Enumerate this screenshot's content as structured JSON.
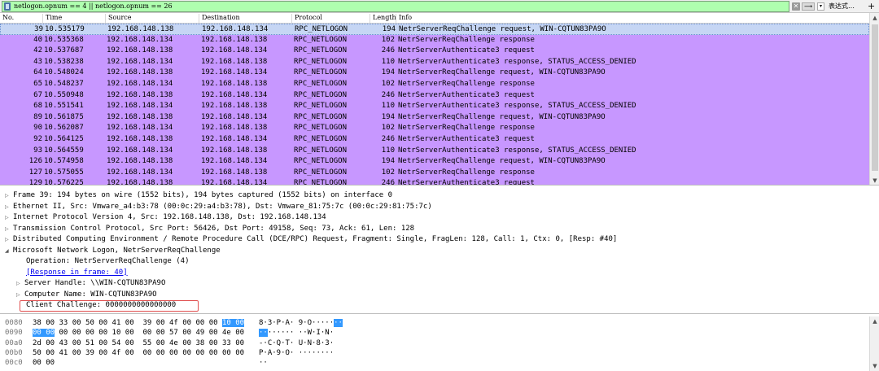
{
  "filter": {
    "expression": "netlogon.opnum == 4 || netlogon.opnum == 26",
    "clear_label": "✕",
    "apply_label": "⟶",
    "dropdown_label": "▾",
    "expression_label": "表达式…",
    "add_label": "+"
  },
  "packet_list": {
    "columns": [
      "No.",
      "Time",
      "Source",
      "Destination",
      "Protocol",
      "Length",
      "Info"
    ],
    "rows": [
      {
        "no": "39",
        "time": "10.535179",
        "src": "192.168.148.138",
        "dst": "192.168.148.134",
        "proto": "RPC_NETLOGON",
        "len": "194",
        "info": "NetrServerReqChallenge request, WIN-CQTUN83PA9O"
      },
      {
        "no": "40",
        "time": "10.535368",
        "src": "192.168.148.134",
        "dst": "192.168.148.138",
        "proto": "RPC_NETLOGON",
        "len": "102",
        "info": "NetrServerReqChallenge response"
      },
      {
        "no": "42",
        "time": "10.537687",
        "src": "192.168.148.138",
        "dst": "192.168.148.134",
        "proto": "RPC_NETLOGON",
        "len": "246",
        "info": "NetrServerAuthenticate3 request"
      },
      {
        "no": "43",
        "time": "10.538238",
        "src": "192.168.148.134",
        "dst": "192.168.148.138",
        "proto": "RPC_NETLOGON",
        "len": "110",
        "info": "NetrServerAuthenticate3 response, STATUS_ACCESS_DENIED"
      },
      {
        "no": "64",
        "time": "10.548024",
        "src": "192.168.148.138",
        "dst": "192.168.148.134",
        "proto": "RPC_NETLOGON",
        "len": "194",
        "info": "NetrServerReqChallenge request, WIN-CQTUN83PA9O"
      },
      {
        "no": "65",
        "time": "10.548237",
        "src": "192.168.148.134",
        "dst": "192.168.148.138",
        "proto": "RPC_NETLOGON",
        "len": "102",
        "info": "NetrServerReqChallenge response"
      },
      {
        "no": "67",
        "time": "10.550948",
        "src": "192.168.148.138",
        "dst": "192.168.148.134",
        "proto": "RPC_NETLOGON",
        "len": "246",
        "info": "NetrServerAuthenticate3 request"
      },
      {
        "no": "68",
        "time": "10.551541",
        "src": "192.168.148.134",
        "dst": "192.168.148.138",
        "proto": "RPC_NETLOGON",
        "len": "110",
        "info": "NetrServerAuthenticate3 response, STATUS_ACCESS_DENIED"
      },
      {
        "no": "89",
        "time": "10.561875",
        "src": "192.168.148.138",
        "dst": "192.168.148.134",
        "proto": "RPC_NETLOGON",
        "len": "194",
        "info": "NetrServerReqChallenge request, WIN-CQTUN83PA9O"
      },
      {
        "no": "90",
        "time": "10.562087",
        "src": "192.168.148.134",
        "dst": "192.168.148.138",
        "proto": "RPC_NETLOGON",
        "len": "102",
        "info": "NetrServerReqChallenge response"
      },
      {
        "no": "92",
        "time": "10.564125",
        "src": "192.168.148.138",
        "dst": "192.168.148.134",
        "proto": "RPC_NETLOGON",
        "len": "246",
        "info": "NetrServerAuthenticate3 request"
      },
      {
        "no": "93",
        "time": "10.564559",
        "src": "192.168.148.134",
        "dst": "192.168.148.138",
        "proto": "RPC_NETLOGON",
        "len": "110",
        "info": "NetrServerAuthenticate3 response, STATUS_ACCESS_DENIED"
      },
      {
        "no": "126",
        "time": "10.574958",
        "src": "192.168.148.138",
        "dst": "192.168.148.134",
        "proto": "RPC_NETLOGON",
        "len": "194",
        "info": "NetrServerReqChallenge request, WIN-CQTUN83PA9O"
      },
      {
        "no": "127",
        "time": "10.575055",
        "src": "192.168.148.134",
        "dst": "192.168.148.138",
        "proto": "RPC_NETLOGON",
        "len": "102",
        "info": "NetrServerReqChallenge response"
      },
      {
        "no": "129",
        "time": "10.576225",
        "src": "192.168.148.138",
        "dst": "192.168.148.134",
        "proto": "RPC_NETLOGON",
        "len": "246",
        "info": "NetrServerAuthenticate3 request"
      }
    ],
    "selected_row": "39",
    "row_color": "#c797ff",
    "selected_color": "#c6d6f4"
  },
  "details": {
    "frame": "Frame 39: 194 bytes on wire (1552 bits), 194 bytes captured (1552 bits) on interface 0",
    "ethernet": "Ethernet II, Src: Vmware_a4:b3:78 (00:0c:29:a4:b3:78), Dst: Vmware_81:75:7c (00:0c:29:81:75:7c)",
    "ip": "Internet Protocol Version 4, Src: 192.168.148.138, Dst: 192.168.148.134",
    "tcp": "Transmission Control Protocol, Src Port: 56426, Dst Port: 49158, Seq: 73, Ack: 61, Len: 128",
    "dcerpc": "Distributed Computing Environment / Remote Procedure Call (DCE/RPC) Request, Fragment: Single, FragLen: 128, Call: 1, Ctx: 0, [Resp: #40]",
    "netlogon": "Microsoft Network Logon, NetrServerReqChallenge",
    "operation": "Operation: NetrServerReqChallenge (4)",
    "response_link": "[Response in frame: 40]",
    "server_handle": "Server Handle: \\\\WIN-CQTUN83PA9O",
    "computer_name": "Computer Name: WIN-CQTUN83PA9O",
    "client_challenge": "Client Challenge: 0000000000000000",
    "highlight_color": "#e05050"
  },
  "bytes": {
    "rows": [
      {
        "off": "0080",
        "hex_pre": "38 00 33 00 50 00 41 00  39 00 4f 00 00 00 ",
        "hex_sel": "10 00",
        "asc_pre": "8·3·P·A· 9·O·····",
        "asc_sel": "··"
      },
      {
        "off": "0090",
        "hex_sel": "00 00",
        "hex_post": " 00 00 00 00 10 00  00 00 57 00 49 00 4e 00",
        "asc_sel": "··",
        "asc_post": "······ ··W·I·N·"
      },
      {
        "off": "00a0",
        "hex_pre": "2d 00 43 00 51 00 54 00  55 00 4e 00 38 00 33 00",
        "asc_pre": "-·C·Q·T· U·N·8·3·"
      },
      {
        "off": "00b0",
        "hex_pre": "50 00 41 00 39 00 4f 00  00 00 00 00 00 00 00 00",
        "asc_pre": "P·A·9·O· ········"
      },
      {
        "off": "00c0",
        "hex_pre": "00 00",
        "asc_pre": "··"
      }
    ],
    "selection_color": "#3399ff"
  }
}
